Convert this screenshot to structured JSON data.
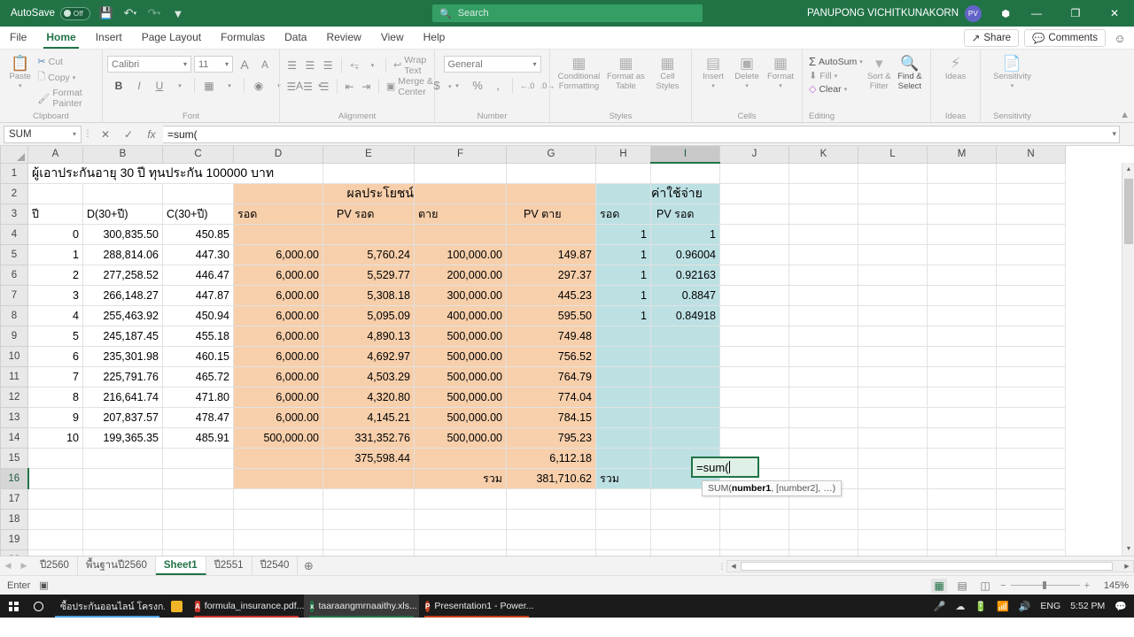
{
  "titlebar": {
    "autosave_label": "AutoSave",
    "autosave_state": "Off",
    "save_icon": "save-icon",
    "undo_icon": "undo-icon",
    "redo_icon": "redo-icon",
    "customize_icon": "customize-quick-access-icon",
    "document_title": "taaraangmrnaaithy.xlsx  -  Excel",
    "search_placeholder": "Search",
    "search_icon": "search-icon",
    "account_name": "PANUPONG VICHITKUNAKORN",
    "account_initials": "PV",
    "ribbon_display_icon": "ribbon-display-options-icon",
    "minimize": "—",
    "restore": "❐",
    "close": "✕"
  },
  "ribbon_tabs": [
    {
      "label": "File",
      "active": false
    },
    {
      "label": "Home",
      "active": true
    },
    {
      "label": "Insert",
      "active": false
    },
    {
      "label": "Page Layout",
      "active": false
    },
    {
      "label": "Formulas",
      "active": false
    },
    {
      "label": "Data",
      "active": false
    },
    {
      "label": "Review",
      "active": false
    },
    {
      "label": "View",
      "active": false
    },
    {
      "label": "Help",
      "active": false
    }
  ],
  "ribbon_right": {
    "share_label": "Share",
    "share_icon": "share-icon",
    "comments_label": "Comments",
    "comments_icon": "comment-icon",
    "smiley_icon": "feedback-smiley-icon"
  },
  "ribbon": {
    "clipboard": {
      "group_name": "Clipboard",
      "paste_label": "Paste",
      "cut_label": "Cut",
      "copy_label": "Copy",
      "format_painter_label": "Format Painter"
    },
    "font": {
      "group_name": "Font",
      "font_name": "Calibri",
      "font_size": "11",
      "grow_font": "A",
      "shrink_font": "A",
      "bold": "B",
      "italic": "I",
      "underline": "U",
      "borders_icon": "borders-icon",
      "fill_color_icon": "fill-color-icon",
      "font_color_icon": "font-color-icon"
    },
    "alignment": {
      "group_name": "Alignment",
      "wrap_text_label": "Wrap Text",
      "merge_center_label": "Merge & Center",
      "orientation_icon": "text-orientation-icon",
      "indent_decrease_icon": "decrease-indent-icon",
      "indent_increase_icon": "increase-indent-icon"
    },
    "number": {
      "group_name": "Number",
      "format_value": "General",
      "currency_icon": "accounting-format-icon",
      "percent_icon": "percent-style-icon",
      "comma_icon": "comma-style-icon",
      "increase_decimal_icon": "increase-decimal-icon",
      "decrease_decimal_icon": "decrease-decimal-icon"
    },
    "styles": {
      "group_name": "Styles",
      "conditional_formatting_label": "Conditional Formatting",
      "format_as_table_label": "Format as Table",
      "cell_styles_label": "Cell Styles"
    },
    "cells": {
      "group_name": "Cells",
      "insert_label": "Insert",
      "delete_label": "Delete",
      "format_label": "Format"
    },
    "editing": {
      "group_name": "Editing",
      "autosum_label": "AutoSum",
      "fill_label": "Fill",
      "clear_label": "Clear",
      "sort_filter_label": "Sort & Filter",
      "find_select_label": "Find & Select"
    },
    "ideas": {
      "group_name": "Ideas",
      "ideas_label": "Ideas"
    },
    "sensitivity": {
      "group_name": "Sensitivity",
      "sensitivity_label": "Sensitivity"
    },
    "collapse_icon": "collapse-ribbon-icon"
  },
  "formula_bar": {
    "name_box_value": "SUM",
    "cancel_icon": "cancel-icon",
    "enter_icon": "enter-icon",
    "insert_function_icon": "insert-function-icon",
    "formula_value": "=sum("
  },
  "grid": {
    "columns": [
      "A",
      "B",
      "C",
      "D",
      "E",
      "F",
      "G",
      "H",
      "I",
      "J",
      "K",
      "L",
      "M",
      "N"
    ],
    "selected_column": "I",
    "selected_row": 16,
    "rows": [
      {
        "n": "1",
        "cells": [
          "ผู้เอาประกันอายุ 30 ปี ทุนประกัน 100000 บาท",
          "",
          "",
          "",
          "",
          "",
          "",
          "",
          "",
          "",
          "",
          "",
          "",
          ""
        ]
      },
      {
        "n": "2",
        "cells": [
          "",
          "",
          "",
          "",
          "ผลประโยชน์",
          "",
          "",
          "",
          "ค่าใช้จ่าย",
          "",
          "",
          "",
          "",
          ""
        ]
      },
      {
        "n": "3",
        "cells": [
          "ปี",
          "D(30+ปี)",
          "C(30+ปี)",
          "รอด",
          "PV รอด",
          "ตาย",
          "PV ตาย",
          "รอด",
          "PV รอด",
          "",
          "",
          "",
          "",
          ""
        ]
      },
      {
        "n": "4",
        "cells": [
          "0",
          "300,835.50",
          "450.85",
          "",
          "",
          "",
          "",
          "1",
          "1",
          "",
          "",
          "",
          "",
          ""
        ]
      },
      {
        "n": "5",
        "cells": [
          "1",
          "288,814.06",
          "447.30",
          "6,000.00",
          "5,760.24",
          "100,000.00",
          "149.87",
          "1",
          "0.96004",
          "",
          "",
          "",
          "",
          ""
        ]
      },
      {
        "n": "6",
        "cells": [
          "2",
          "277,258.52",
          "446.47",
          "6,000.00",
          "5,529.77",
          "200,000.00",
          "297.37",
          "1",
          "0.92163",
          "",
          "",
          "",
          "",
          ""
        ]
      },
      {
        "n": "7",
        "cells": [
          "3",
          "266,148.27",
          "447.87",
          "6,000.00",
          "5,308.18",
          "300,000.00",
          "445.23",
          "1",
          "0.8847",
          "",
          "",
          "",
          "",
          ""
        ]
      },
      {
        "n": "8",
        "cells": [
          "4",
          "255,463.92",
          "450.94",
          "6,000.00",
          "5,095.09",
          "400,000.00",
          "595.50",
          "1",
          "0.84918",
          "",
          "",
          "",
          "",
          ""
        ]
      },
      {
        "n": "9",
        "cells": [
          "5",
          "245,187.45",
          "455.18",
          "6,000.00",
          "4,890.13",
          "500,000.00",
          "749.48",
          "",
          "",
          "",
          "",
          "",
          "",
          ""
        ]
      },
      {
        "n": "10",
        "cells": [
          "6",
          "235,301.98",
          "460.15",
          "6,000.00",
          "4,692.97",
          "500,000.00",
          "756.52",
          "",
          "",
          "",
          "",
          "",
          "",
          ""
        ]
      },
      {
        "n": "11",
        "cells": [
          "7",
          "225,791.76",
          "465.72",
          "6,000.00",
          "4,503.29",
          "500,000.00",
          "764.79",
          "",
          "",
          "",
          "",
          "",
          "",
          ""
        ]
      },
      {
        "n": "12",
        "cells": [
          "8",
          "216,641.74",
          "471.80",
          "6,000.00",
          "4,320.80",
          "500,000.00",
          "774.04",
          "",
          "",
          "",
          "",
          "",
          "",
          ""
        ]
      },
      {
        "n": "13",
        "cells": [
          "9",
          "207,837.57",
          "478.47",
          "6,000.00",
          "4,145.21",
          "500,000.00",
          "784.15",
          "",
          "",
          "",
          "",
          "",
          "",
          ""
        ]
      },
      {
        "n": "14",
        "cells": [
          "10",
          "199,365.35",
          "485.91",
          "500,000.00",
          "331,352.76",
          "500,000.00",
          "795.23",
          "",
          "",
          "",
          "",
          "",
          "",
          ""
        ]
      },
      {
        "n": "15",
        "cells": [
          "",
          "",
          "",
          "",
          "375,598.44",
          "",
          "6,112.18",
          "",
          "",
          "",
          "",
          "",
          "",
          ""
        ]
      },
      {
        "n": "16",
        "cells": [
          "",
          "",
          "",
          "",
          "",
          "รวม",
          "381,710.62",
          "รวม",
          "",
          "",
          "",
          "",
          "",
          ""
        ]
      },
      {
        "n": "17",
        "cells": [
          "",
          "",
          "",
          "",
          "",
          "",
          "",
          "",
          "",
          "",
          "",
          "",
          "",
          ""
        ]
      },
      {
        "n": "18",
        "cells": [
          "",
          "",
          "",
          "",
          "",
          "",
          "",
          "",
          "",
          "",
          "",
          "",
          "",
          ""
        ]
      },
      {
        "n": "19",
        "cells": [
          "",
          "",
          "",
          "",
          "",
          "",
          "",
          "",
          "",
          "",
          "",
          "",
          "",
          ""
        ]
      },
      {
        "n": "20",
        "cells": [
          "",
          "",
          "",
          "",
          "",
          "",
          "",
          "",
          "",
          "",
          "",
          "",
          "",
          ""
        ]
      }
    ],
    "active_cell": {
      "address": "I16",
      "value": "=sum("
    },
    "tooltip": {
      "prefix": "SUM(",
      "arg1": "number1",
      "rest": ", [number2], …)"
    },
    "fill_orange": "#f7cfab",
    "fill_cyan": "#bde0e3",
    "accent_green": "#217346"
  },
  "sheet_tabs": {
    "tabs": [
      {
        "label": "ปี2560",
        "active": false
      },
      {
        "label": "พื้นฐานปี2560",
        "active": false
      },
      {
        "label": "Sheet1",
        "active": true
      },
      {
        "label": "ปี2551",
        "active": false
      },
      {
        "label": "ปี2540",
        "active": false
      }
    ],
    "add_sheet_icon": "add-sheet-icon",
    "prev_icon": "previous-sheet-icon",
    "next_icon": "next-sheet-icon"
  },
  "status_bar": {
    "mode": "Enter",
    "macro_icon": "record-macro-icon",
    "view_normal_icon": "normal-view-icon",
    "view_page_layout_icon": "page-layout-view-icon",
    "view_page_break_icon": "page-break-preview-icon",
    "zoom_out": "−",
    "zoom_in": "+",
    "zoom_level": "145%"
  },
  "taskbar": {
    "start_icon": "windows-start-icon",
    "cortana_icon": "cortana-search-icon",
    "items": [
      {
        "label": "ซื้อประกันออนไลน์ โครงก...",
        "icon": "chrome-icon",
        "icon_color": "#e8532f",
        "icon_text": "",
        "active": false,
        "underline": "#4a9fe0"
      },
      {
        "label": "",
        "icon": "file-explorer-icon",
        "icon_color": "#f0b429",
        "icon_text": "",
        "active": false,
        "underline": ""
      },
      {
        "label": "formula_insurance.pdf...",
        "icon": "pdf-icon",
        "icon_color": "#c8342b",
        "icon_text": "A",
        "active": false,
        "underline": "#c8342b"
      },
      {
        "label": "taaraangmrnaaithy.xls...",
        "icon": "excel-icon",
        "icon_color": "#217346",
        "icon_text": "x",
        "active": true,
        "underline": "#217346"
      },
      {
        "label": "Presentation1 - Power...",
        "icon": "powerpoint-icon",
        "icon_color": "#c43e1c",
        "icon_text": "P",
        "active": false,
        "underline": "#c43e1c"
      }
    ],
    "tray": {
      "mic_icon": "microphone-icon",
      "onedrive_icon": "onedrive-icon",
      "battery_icon": "battery-icon",
      "wifi_icon": "wifi-icon",
      "volume_icon": "volume-icon",
      "language": "ENG",
      "time": "5:52 PM",
      "notifications_icon": "notifications-icon"
    }
  }
}
